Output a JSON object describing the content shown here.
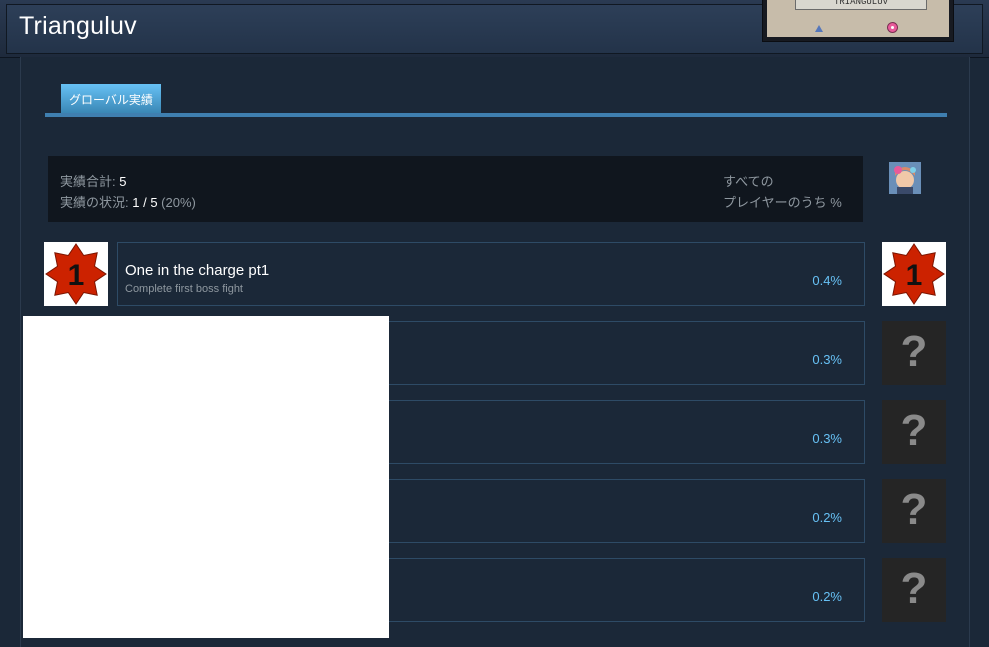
{
  "header": {
    "game_title": "Trianguluv",
    "logo_text": "TRIANGULUV"
  },
  "tabs": [
    {
      "label": "グローバル実績",
      "active": true
    }
  ],
  "summary": {
    "total_label": "実績合計:",
    "total_value": "5",
    "progress_label": "実績の状況:",
    "progress_value": "1 / 5",
    "progress_percent": "(20%)",
    "all_players_line1": "すべての",
    "all_players_line2": "プレイヤーのうち %"
  },
  "achievements": [
    {
      "title": "One in the charge pt1",
      "description": "Complete first boss fight",
      "percent": "0.4%",
      "unlocked": true,
      "icon": "badge-one-icon"
    },
    {
      "title": "",
      "description": "",
      "percent": "0.3%",
      "unlocked": false,
      "icon": "question-mark-icon"
    },
    {
      "title": "",
      "description": "",
      "percent": "0.3%",
      "unlocked": false,
      "icon": "question-mark-icon"
    },
    {
      "title": "",
      "description": "",
      "percent": "0.2%",
      "unlocked": false,
      "icon": "question-mark-icon"
    },
    {
      "title": "",
      "description": "",
      "percent": "0.2%",
      "unlocked": false,
      "icon": "question-mark-icon"
    }
  ],
  "hidden_icon_glyph": "?",
  "badge_glyph": "1",
  "colors": {
    "accent": "#67c1f5",
    "badge_red": "#cc2200",
    "background": "#1b2838"
  }
}
